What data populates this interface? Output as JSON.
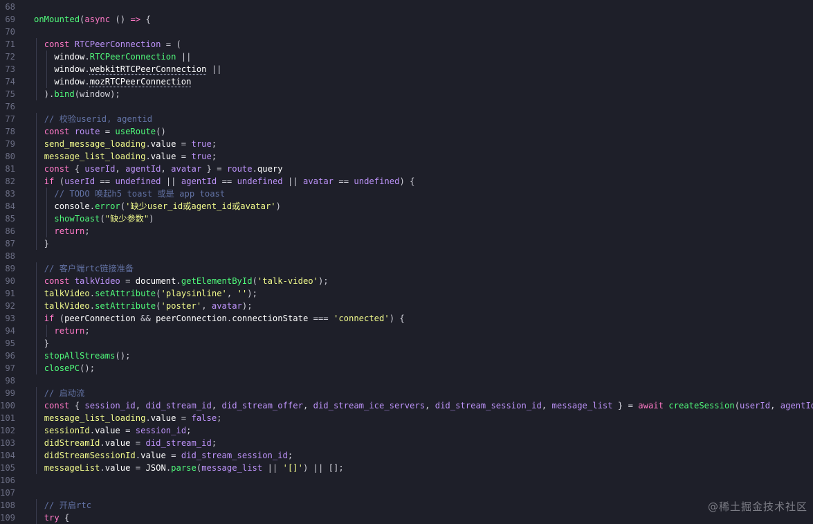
{
  "editor": {
    "lines": [
      {
        "n": "68",
        "indent": 0,
        "tokens": []
      },
      {
        "n": "69",
        "indent": 0,
        "tokens": [
          [
            "f",
            "onMounted"
          ],
          [
            "p",
            "("
          ],
          [
            "k",
            "async"
          ],
          [
            "p",
            " () "
          ],
          [
            "k",
            "=>"
          ],
          [
            "p",
            " {"
          ]
        ]
      },
      {
        "n": "70",
        "indent": 1,
        "tokens": []
      },
      {
        "n": "71",
        "indent": 1,
        "tokens": [
          [
            "p",
            "  "
          ],
          [
            "k",
            "const"
          ],
          [
            "p",
            " "
          ],
          [
            "b",
            "RTCPeerConnection"
          ],
          [
            "p",
            " = ("
          ]
        ]
      },
      {
        "n": "72",
        "indent": 2,
        "tokens": [
          [
            "p",
            "    "
          ],
          [
            "v",
            "window"
          ],
          [
            "p",
            "."
          ],
          [
            "g",
            "RTCPeerConnection"
          ],
          [
            "p",
            " ||"
          ]
        ]
      },
      {
        "n": "73",
        "indent": 2,
        "tokens": [
          [
            "p",
            "    "
          ],
          [
            "v",
            "window"
          ],
          [
            "p",
            "."
          ],
          [
            "sq",
            "webkitRTCPeerConnection"
          ],
          [
            "p",
            " ||"
          ]
        ]
      },
      {
        "n": "74",
        "indent": 2,
        "tokens": [
          [
            "p",
            "    "
          ],
          [
            "v",
            "window"
          ],
          [
            "p",
            "."
          ],
          [
            "sq",
            "mozRTCPeerConnection"
          ]
        ]
      },
      {
        "n": "75",
        "indent": 1,
        "tokens": [
          [
            "p",
            "  )."
          ],
          [
            "f",
            "bind"
          ],
          [
            "p",
            "(window);"
          ]
        ]
      },
      {
        "n": "76",
        "indent": 1,
        "tokens": []
      },
      {
        "n": "77",
        "indent": 1,
        "tokens": [
          [
            "p",
            "  "
          ],
          [
            "m",
            "// 校验userid, agentid"
          ]
        ]
      },
      {
        "n": "78",
        "indent": 1,
        "tokens": [
          [
            "p",
            "  "
          ],
          [
            "k",
            "const"
          ],
          [
            "p",
            " "
          ],
          [
            "b",
            "route"
          ],
          [
            "p",
            " = "
          ],
          [
            "f",
            "useRoute"
          ],
          [
            "p",
            "()"
          ]
        ]
      },
      {
        "n": "79",
        "indent": 1,
        "tokens": [
          [
            "p",
            "  "
          ],
          [
            "y",
            "send_message_loading"
          ],
          [
            "p",
            "."
          ],
          [
            "v",
            "value"
          ],
          [
            "p",
            " = "
          ],
          [
            "b",
            "true"
          ],
          [
            "p",
            ";"
          ]
        ]
      },
      {
        "n": "80",
        "indent": 1,
        "tokens": [
          [
            "p",
            "  "
          ],
          [
            "y",
            "message_list_loading"
          ],
          [
            "p",
            "."
          ],
          [
            "v",
            "value"
          ],
          [
            "p",
            " = "
          ],
          [
            "b",
            "true"
          ],
          [
            "p",
            ";"
          ]
        ]
      },
      {
        "n": "81",
        "indent": 1,
        "tokens": [
          [
            "p",
            "  "
          ],
          [
            "k",
            "const"
          ],
          [
            "p",
            " { "
          ],
          [
            "b",
            "userId"
          ],
          [
            "p",
            ", "
          ],
          [
            "b",
            "agentId"
          ],
          [
            "p",
            ", "
          ],
          [
            "b",
            "avatar"
          ],
          [
            "p",
            " } = "
          ],
          [
            "b",
            "route"
          ],
          [
            "p",
            "."
          ],
          [
            "v",
            "query"
          ]
        ]
      },
      {
        "n": "82",
        "indent": 1,
        "tokens": [
          [
            "p",
            "  "
          ],
          [
            "k",
            "if"
          ],
          [
            "p",
            " ("
          ],
          [
            "b",
            "userId"
          ],
          [
            "p",
            " == "
          ],
          [
            "b",
            "undefined"
          ],
          [
            "p",
            " || "
          ],
          [
            "b",
            "agentId"
          ],
          [
            "p",
            " == "
          ],
          [
            "b",
            "undefined"
          ],
          [
            "p",
            " || "
          ],
          [
            "b",
            "avatar"
          ],
          [
            "p",
            " == "
          ],
          [
            "b",
            "undefined"
          ],
          [
            "p",
            ") {"
          ]
        ]
      },
      {
        "n": "83",
        "indent": 2,
        "tokens": [
          [
            "p",
            "    "
          ],
          [
            "m",
            "// TODO 唤起h5 toast 或是 app toast"
          ]
        ]
      },
      {
        "n": "84",
        "indent": 2,
        "tokens": [
          [
            "p",
            "    "
          ],
          [
            "v",
            "console"
          ],
          [
            "p",
            "."
          ],
          [
            "f",
            "error"
          ],
          [
            "p",
            "("
          ],
          [
            "s",
            "'缺少user_id或agent_id或avatar'"
          ],
          [
            "p",
            ")"
          ]
        ]
      },
      {
        "n": "85",
        "indent": 2,
        "tokens": [
          [
            "p",
            "    "
          ],
          [
            "f",
            "showToast"
          ],
          [
            "p",
            "("
          ],
          [
            "s",
            "\"缺少参数\""
          ],
          [
            "p",
            ")"
          ]
        ]
      },
      {
        "n": "86",
        "indent": 2,
        "tokens": [
          [
            "p",
            "    "
          ],
          [
            "k",
            "return"
          ],
          [
            "p",
            ";"
          ]
        ]
      },
      {
        "n": "87",
        "indent": 1,
        "tokens": [
          [
            "p",
            "  }"
          ]
        ]
      },
      {
        "n": "88",
        "indent": 1,
        "tokens": []
      },
      {
        "n": "89",
        "indent": 1,
        "tokens": [
          [
            "p",
            "  "
          ],
          [
            "m",
            "// 客户端rtc链接准备"
          ]
        ]
      },
      {
        "n": "90",
        "indent": 1,
        "tokens": [
          [
            "p",
            "  "
          ],
          [
            "k",
            "const"
          ],
          [
            "p",
            " "
          ],
          [
            "b",
            "talkVideo"
          ],
          [
            "p",
            " = "
          ],
          [
            "v",
            "document"
          ],
          [
            "p",
            "."
          ],
          [
            "f",
            "getElementById"
          ],
          [
            "p",
            "("
          ],
          [
            "s",
            "'talk-video'"
          ],
          [
            "p",
            ");"
          ]
        ]
      },
      {
        "n": "91",
        "indent": 1,
        "tokens": [
          [
            "p",
            "  "
          ],
          [
            "y",
            "talkVideo"
          ],
          [
            "p",
            "."
          ],
          [
            "f",
            "setAttribute"
          ],
          [
            "p",
            "("
          ],
          [
            "s",
            "'playsinline'"
          ],
          [
            "p",
            ", "
          ],
          [
            "s",
            "''"
          ],
          [
            "p",
            ");"
          ]
        ]
      },
      {
        "n": "92",
        "indent": 1,
        "tokens": [
          [
            "p",
            "  "
          ],
          [
            "y",
            "talkVideo"
          ],
          [
            "p",
            "."
          ],
          [
            "f",
            "setAttribute"
          ],
          [
            "p",
            "("
          ],
          [
            "s",
            "'poster'"
          ],
          [
            "p",
            ", "
          ],
          [
            "b",
            "avatar"
          ],
          [
            "p",
            ");"
          ]
        ]
      },
      {
        "n": "93",
        "indent": 1,
        "tokens": [
          [
            "p",
            "  "
          ],
          [
            "k",
            "if"
          ],
          [
            "p",
            " ("
          ],
          [
            "v",
            "peerConnection"
          ],
          [
            "p",
            " && "
          ],
          [
            "v",
            "peerConnection"
          ],
          [
            "p",
            "."
          ],
          [
            "v",
            "connectionState"
          ],
          [
            "p",
            " === "
          ],
          [
            "s",
            "'connected'"
          ],
          [
            "p",
            ") {"
          ]
        ]
      },
      {
        "n": "94",
        "indent": 2,
        "tokens": [
          [
            "p",
            "    "
          ],
          [
            "k",
            "return"
          ],
          [
            "p",
            ";"
          ]
        ]
      },
      {
        "n": "95",
        "indent": 1,
        "tokens": [
          [
            "p",
            "  }"
          ]
        ]
      },
      {
        "n": "96",
        "indent": 1,
        "tokens": [
          [
            "p",
            "  "
          ],
          [
            "f",
            "stopAllStreams"
          ],
          [
            "p",
            "();"
          ]
        ]
      },
      {
        "n": "97",
        "indent": 1,
        "tokens": [
          [
            "p",
            "  "
          ],
          [
            "f",
            "closePC"
          ],
          [
            "p",
            "();"
          ]
        ]
      },
      {
        "n": "98",
        "indent": 1,
        "tokens": []
      },
      {
        "n": "99",
        "indent": 1,
        "tokens": [
          [
            "p",
            "  "
          ],
          [
            "m",
            "// 启动流"
          ]
        ]
      },
      {
        "n": "100",
        "indent": 1,
        "tokens": [
          [
            "p",
            "  "
          ],
          [
            "k",
            "const"
          ],
          [
            "p",
            " { "
          ],
          [
            "b",
            "session_id"
          ],
          [
            "p",
            ", "
          ],
          [
            "b",
            "did_stream_id"
          ],
          [
            "p",
            ", "
          ],
          [
            "b",
            "did_stream_offer"
          ],
          [
            "p",
            ", "
          ],
          [
            "b",
            "did_stream_ice_servers"
          ],
          [
            "p",
            ", "
          ],
          [
            "b",
            "did_stream_session_id"
          ],
          [
            "p",
            ", "
          ],
          [
            "b",
            "message_list"
          ],
          [
            "p",
            " } = "
          ],
          [
            "k",
            "await"
          ],
          [
            "p",
            " "
          ],
          [
            "f",
            "createSession"
          ],
          [
            "p",
            "("
          ],
          [
            "b",
            "userId"
          ],
          [
            "p",
            ", "
          ],
          [
            "b",
            "agentId"
          ],
          [
            "p",
            ");"
          ]
        ]
      },
      {
        "n": "101",
        "indent": 1,
        "tokens": [
          [
            "p",
            "  "
          ],
          [
            "y",
            "message_list_loading"
          ],
          [
            "p",
            "."
          ],
          [
            "v",
            "value"
          ],
          [
            "p",
            " = "
          ],
          [
            "b",
            "false"
          ],
          [
            "p",
            ";"
          ]
        ]
      },
      {
        "n": "102",
        "indent": 1,
        "tokens": [
          [
            "p",
            "  "
          ],
          [
            "y",
            "sessionId"
          ],
          [
            "p",
            "."
          ],
          [
            "v",
            "value"
          ],
          [
            "p",
            " = "
          ],
          [
            "b",
            "session_id"
          ],
          [
            "p",
            ";"
          ]
        ]
      },
      {
        "n": "103",
        "indent": 1,
        "tokens": [
          [
            "p",
            "  "
          ],
          [
            "y",
            "didStreamId"
          ],
          [
            "p",
            "."
          ],
          [
            "v",
            "value"
          ],
          [
            "p",
            " = "
          ],
          [
            "b",
            "did_stream_id"
          ],
          [
            "p",
            ";"
          ]
        ]
      },
      {
        "n": "104",
        "indent": 1,
        "tokens": [
          [
            "p",
            "  "
          ],
          [
            "y",
            "didStreamSessionId"
          ],
          [
            "p",
            "."
          ],
          [
            "v",
            "value"
          ],
          [
            "p",
            " = "
          ],
          [
            "b",
            "did_stream_session_id"
          ],
          [
            "p",
            ";"
          ]
        ]
      },
      {
        "n": "105",
        "indent": 1,
        "tokens": [
          [
            "p",
            "  "
          ],
          [
            "y",
            "messageList"
          ],
          [
            "p",
            "."
          ],
          [
            "v",
            "value"
          ],
          [
            "p",
            " = "
          ],
          [
            "v",
            "JSON"
          ],
          [
            "p",
            "."
          ],
          [
            "f",
            "parse"
          ],
          [
            "p",
            "("
          ],
          [
            "b",
            "message_list"
          ],
          [
            "p",
            " || "
          ],
          [
            "s",
            "'[]'"
          ],
          [
            "p",
            ") || [];"
          ]
        ]
      },
      {
        "n": "106",
        "indent": 1,
        "tokens": []
      },
      {
        "n": "107",
        "indent": 1,
        "tokens": []
      },
      {
        "n": "108",
        "indent": 1,
        "tokens": [
          [
            "p",
            "  "
          ],
          [
            "m",
            "// 开启rtc"
          ]
        ]
      },
      {
        "n": "109",
        "indent": 1,
        "tokens": [
          [
            "p",
            "  "
          ],
          [
            "k",
            "try"
          ],
          [
            "p",
            " {"
          ]
        ]
      }
    ]
  },
  "watermark": "@稀土掘金技术社区",
  "colors": {
    "background": "#1e1f29",
    "line_number": "#6b6e84",
    "keyword": "#ff79c6",
    "string": "#f1fa8c",
    "function": "#50fa7b",
    "comment": "#6272a4",
    "variable": "#bd93f9"
  }
}
